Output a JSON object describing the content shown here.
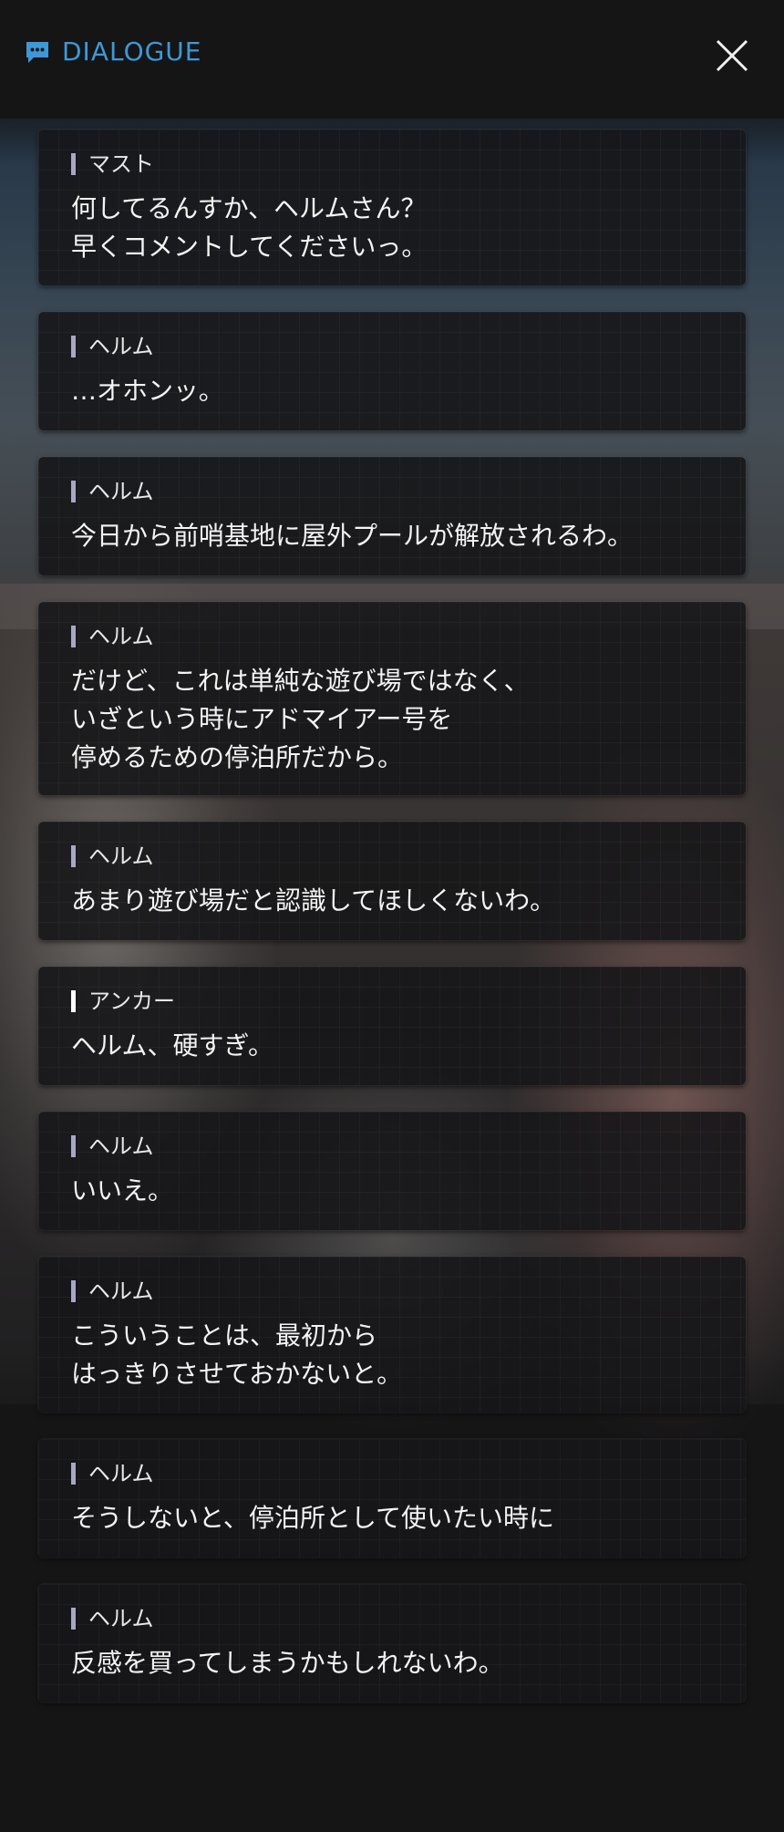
{
  "header": {
    "title": "DIALOGUE",
    "title_color": "#3e98d8",
    "icon": "chat-bubble-icon",
    "close_icon": "close-icon"
  },
  "colors": {
    "speaker_bar": "#a8a7c4",
    "speaker_bar_highlight": "#ffffff",
    "card_background": "#161618"
  },
  "dialogue": [
    {
      "speaker": "マスト",
      "text": "何してるんすか、ヘルムさん？\n早くコメントしてくださいっ。"
    },
    {
      "speaker": "ヘルム",
      "text": "…オホンッ。"
    },
    {
      "speaker": "ヘルム",
      "text": "今日から前哨基地に屋外プールが解放されるわ。"
    },
    {
      "speaker": "ヘルム",
      "text": "だけど、これは単純な遊び場ではなく、\nいざという時にアドマイアー号を\n停めるための停泊所だから。"
    },
    {
      "speaker": "ヘルム",
      "text": "あまり遊び場だと認識してほしくないわ。"
    },
    {
      "speaker": "アンカー",
      "text": "ヘルム、硬すぎ。"
    },
    {
      "speaker": "ヘルム",
      "text": "いいえ。"
    },
    {
      "speaker": "ヘルム",
      "text": "こういうことは、最初から\nはっきりさせておかないと。"
    },
    {
      "speaker": "ヘルム",
      "text": "そうしないと、停泊所として使いたい時に"
    },
    {
      "speaker": "ヘルム",
      "text": "反感を買ってしまうかもしれないわ。"
    }
  ]
}
